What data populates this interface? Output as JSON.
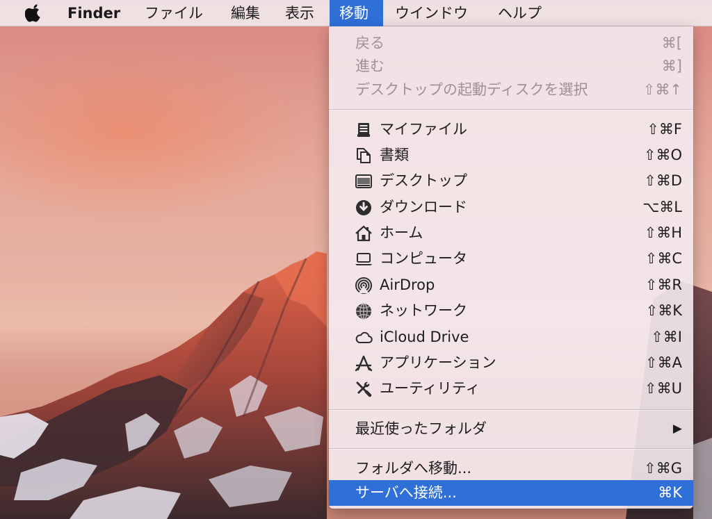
{
  "menubar": {
    "app_name": "Finder",
    "items": [
      "ファイル",
      "編集",
      "表示",
      "移動",
      "ウインドウ",
      "ヘルプ"
    ],
    "active_item": "移動"
  },
  "go_menu": {
    "group1": [
      {
        "label": "戻る",
        "shortcut": "⌘[",
        "enabled": false
      },
      {
        "label": "進む",
        "shortcut": "⌘]",
        "enabled": false
      },
      {
        "label": "デスクトップの起動ディスクを選択",
        "shortcut": "⇧⌘↑",
        "enabled": false
      }
    ],
    "group2": [
      {
        "label": "マイファイル",
        "shortcut": "⇧⌘F",
        "icon": "all-my-files-icon"
      },
      {
        "label": "書類",
        "shortcut": "⇧⌘O",
        "icon": "documents-icon"
      },
      {
        "label": "デスクトップ",
        "shortcut": "⇧⌘D",
        "icon": "desktop-icon"
      },
      {
        "label": "ダウンロード",
        "shortcut": "⌥⌘L",
        "icon": "downloads-icon"
      },
      {
        "label": "ホーム",
        "shortcut": "⇧⌘H",
        "icon": "home-icon"
      },
      {
        "label": "コンピュータ",
        "shortcut": "⇧⌘C",
        "icon": "computer-icon"
      },
      {
        "label": "AirDrop",
        "shortcut": "⇧⌘R",
        "icon": "airdrop-icon"
      },
      {
        "label": "ネットワーク",
        "shortcut": "⇧⌘K",
        "icon": "network-icon"
      },
      {
        "label": "iCloud Drive",
        "shortcut": "⇧⌘I",
        "icon": "icloud-icon"
      },
      {
        "label": "アプリケーション",
        "shortcut": "⇧⌘A",
        "icon": "applications-icon"
      },
      {
        "label": "ユーティリティ",
        "shortcut": "⇧⌘U",
        "icon": "utilities-icon"
      }
    ],
    "group3": [
      {
        "label": "最近使ったフォルダ",
        "submenu_arrow": "▶"
      }
    ],
    "group4": [
      {
        "label": "フォルダへ移動...",
        "shortcut": "⇧⌘G"
      },
      {
        "label": "サーバへ接続...",
        "shortcut": "⌘K",
        "highlighted": true
      }
    ]
  },
  "colors": {
    "highlight": "#2f6fd8",
    "menu_text": "#1c1c1c",
    "disabled_text": "#9c9296"
  }
}
